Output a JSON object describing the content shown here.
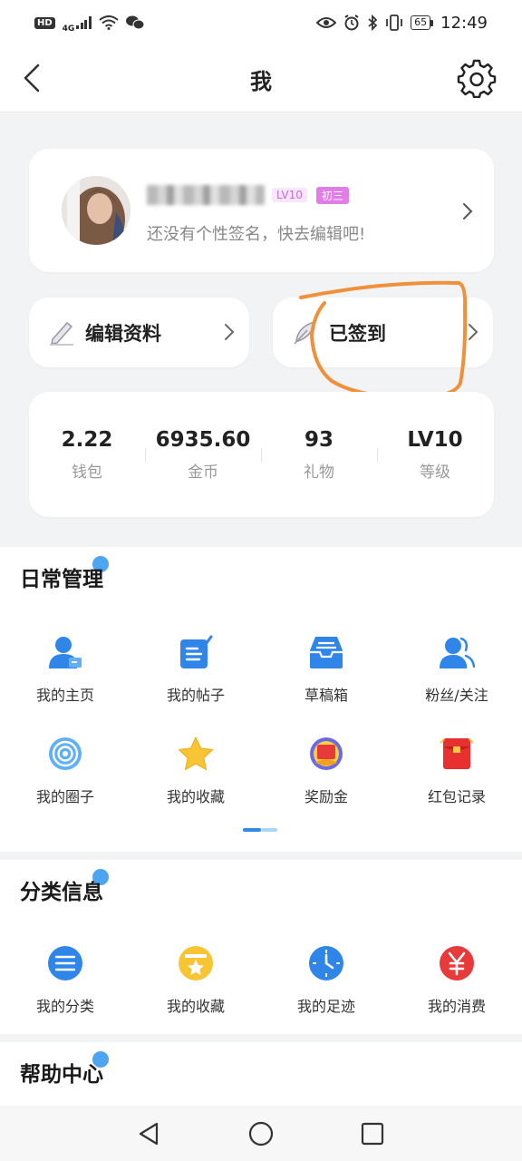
{
  "status_bar": {
    "hd": "HD",
    "network": "4G",
    "battery": "65",
    "time": "12:49"
  },
  "nav": {
    "title": "我"
  },
  "profile": {
    "level_tag": "LV10",
    "grade_tag": "初三",
    "signature": "还没有个性签名，快去编辑吧!"
  },
  "actions": {
    "edit_label": "编辑资料",
    "sign_label": "已签到"
  },
  "stats": [
    {
      "value": "2.22",
      "label": "钱包"
    },
    {
      "value": "6935.60",
      "label": "金币"
    },
    {
      "value": "93",
      "label": "礼物"
    },
    {
      "value": "LV10",
      "label": "等级"
    }
  ],
  "daily": {
    "title": "日常管理",
    "items": [
      {
        "label": "我的主页",
        "icon": "homepage-icon"
      },
      {
        "label": "我的帖子",
        "icon": "posts-icon"
      },
      {
        "label": "草稿箱",
        "icon": "drafts-icon"
      },
      {
        "label": "粉丝/关注",
        "icon": "followers-icon"
      },
      {
        "label": "我的圈子",
        "icon": "circle-icon"
      },
      {
        "label": "我的收藏",
        "icon": "star-icon"
      },
      {
        "label": "奖励金",
        "icon": "reward-icon"
      },
      {
        "label": "红包记录",
        "icon": "red-packet-icon"
      }
    ]
  },
  "category": {
    "title": "分类信息",
    "items": [
      {
        "label": "我的分类",
        "icon": "category-list-icon"
      },
      {
        "label": "我的收藏",
        "icon": "favorites-folder-icon"
      },
      {
        "label": "我的足迹",
        "icon": "clock-icon"
      },
      {
        "label": "我的消费",
        "icon": "yuan-icon"
      }
    ]
  },
  "help": {
    "title": "帮助中心"
  },
  "colors": {
    "accent_blue": "#2b8be6",
    "annotation_orange": "#f0903a",
    "tag_pink": "#e07ee6"
  }
}
